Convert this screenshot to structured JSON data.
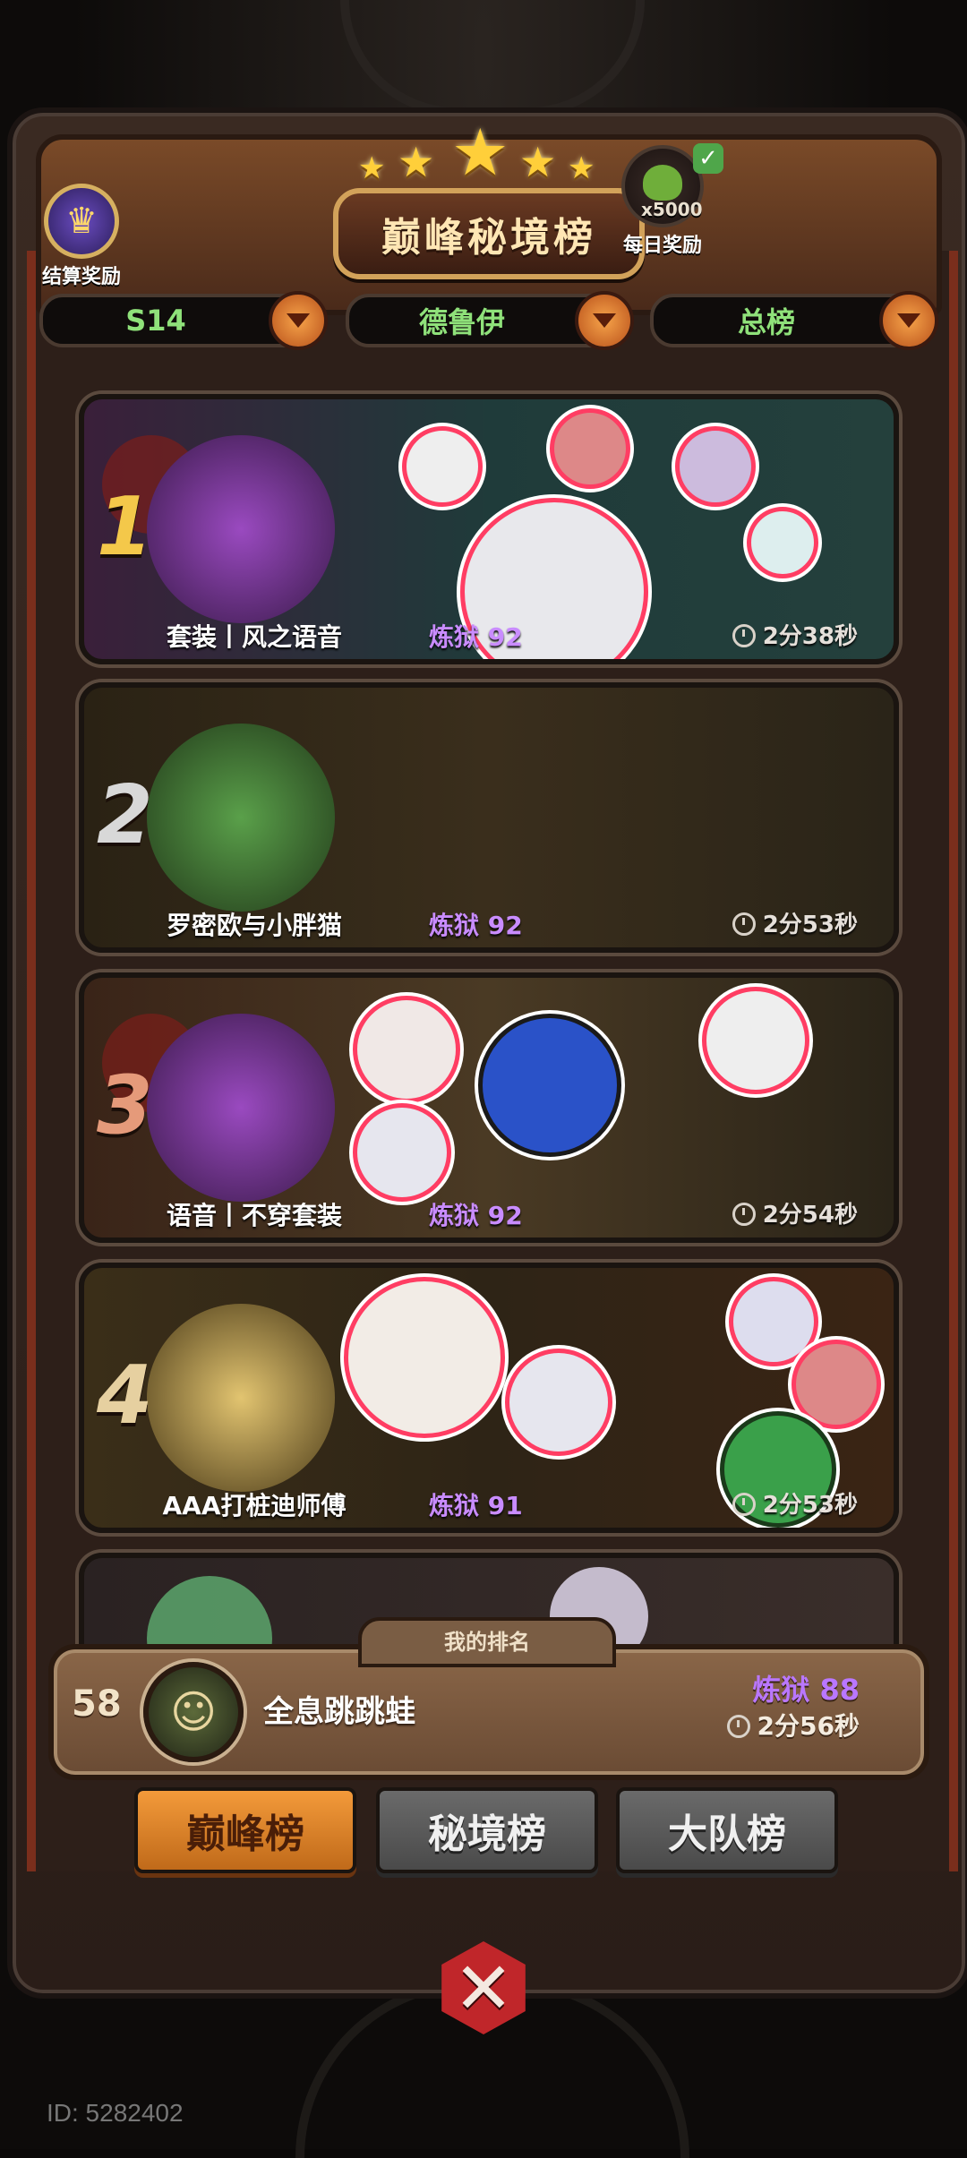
{
  "header": {
    "title": "巅峰秘境榜",
    "settle_reward_label": "结算奖励",
    "daily_reward_label": "每日奖励",
    "daily_reward_count": "x5000"
  },
  "filters": [
    {
      "label": "S14"
    },
    {
      "label": "德鲁伊"
    },
    {
      "label": "总榜"
    }
  ],
  "rankings": [
    {
      "rank": "1",
      "team": "套装丨风之语音",
      "score": "炼狱 92",
      "time": "2分38秒"
    },
    {
      "rank": "2",
      "team": "罗密欧与小胖猫",
      "score": "炼狱 92",
      "time": "2分53秒"
    },
    {
      "rank": "3",
      "team": "语音丨不穿套装",
      "score": "炼狱 92",
      "time": "2分54秒"
    },
    {
      "rank": "4",
      "team": "AAA打桩迪师傅",
      "score": "炼狱 91",
      "time": "2分53秒"
    }
  ],
  "my_rank": {
    "tab_label": "我的排名",
    "position": "58",
    "name": "全息跳跳蛙",
    "score": "炼狱 88",
    "time": "2分56秒"
  },
  "bottom_tabs": [
    {
      "label": "巅峰榜",
      "active": true
    },
    {
      "label": "秘境榜",
      "active": false
    },
    {
      "label": "大队榜",
      "active": false
    }
  ],
  "footer": {
    "id_text": "ID: 5282402"
  },
  "colors": {
    "score_purple": "#c98cff",
    "filter_green": "#8fe17a",
    "active_tab": "#f39a3a",
    "close_red": "#c0262a"
  }
}
